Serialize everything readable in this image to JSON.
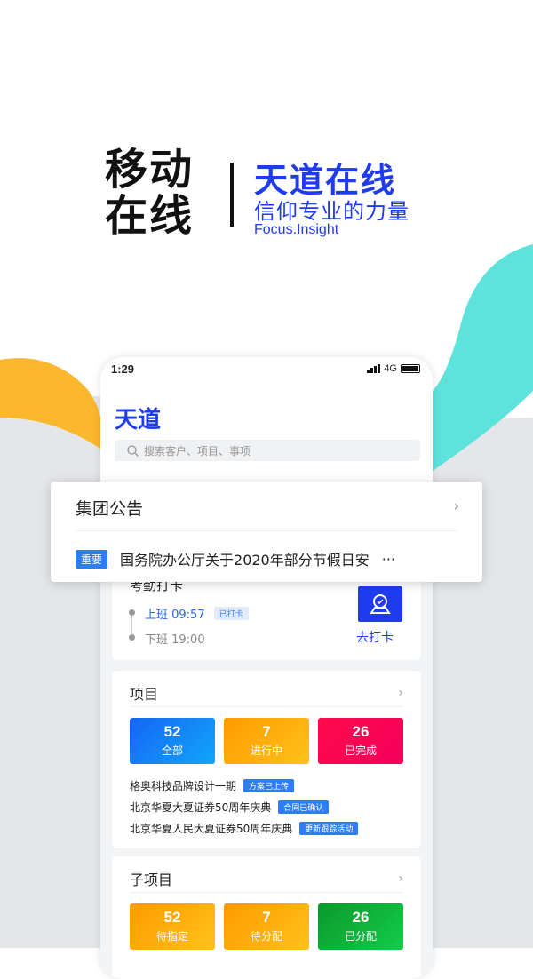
{
  "hero": {
    "left_line1": "移动",
    "left_line2": "在线",
    "title": "天道在线",
    "subtitle": "信仰专业的力量",
    "english": "Focus.Insight"
  },
  "colors": {
    "brand": "#1f3bf0",
    "teal": "#5de3dc",
    "yellow": "#fbb72d",
    "tag": "#2f7df6"
  },
  "phone": {
    "status": {
      "time": "1:29",
      "network": "4G"
    },
    "app_title": "天道",
    "search": {
      "placeholder": "搜索客户、项目、事项",
      "icon": "search-icon"
    },
    "notice": {
      "title": "集团公告",
      "badge": "重要",
      "text": "国务院办公厅关于2020年部分节假日安",
      "more": "···"
    },
    "attendance": {
      "title": "考勤打卡",
      "on_duty": "上班 09:57",
      "on_status": "已打卡",
      "off_duty": "下班 19:00",
      "action": "去打卡"
    },
    "projects": {
      "title": "项目",
      "stats": [
        {
          "value": "52",
          "label": "全部"
        },
        {
          "value": "7",
          "label": "进行中"
        },
        {
          "value": "26",
          "label": "已完成"
        }
      ],
      "items": [
        {
          "name": "格奥科技品牌设计一期",
          "tag": "方案已上传"
        },
        {
          "name": "北京华夏大夏证券50周年庆典",
          "tag": "合同已确认"
        },
        {
          "name": "北京华夏人民大夏证券50周年庆典",
          "tag": "更新跟踪活动"
        }
      ]
    },
    "subprojects": {
      "title": "子项目",
      "stats": [
        {
          "value": "52",
          "label": "待指定"
        },
        {
          "value": "7",
          "label": "待分配"
        },
        {
          "value": "26",
          "label": "已分配"
        }
      ]
    }
  }
}
